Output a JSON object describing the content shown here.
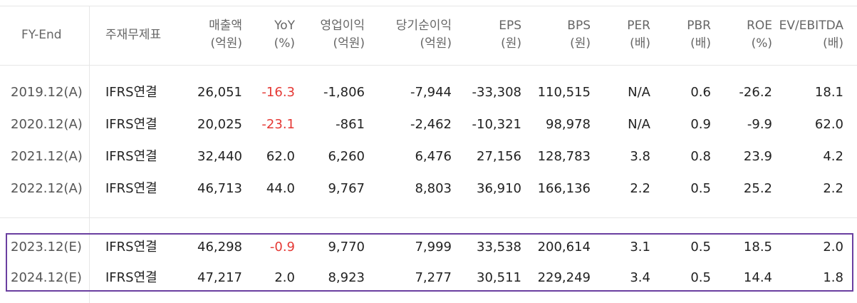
{
  "header": {
    "fy_end": "FY-End",
    "jaemu": "주재무제표",
    "cols": [
      {
        "l1": "매출액",
        "l2": "(억원)"
      },
      {
        "l1": "YoY",
        "l2": "(%)"
      },
      {
        "l1": "영업이익",
        "l2": "(억원)"
      },
      {
        "l1": "당기순이익",
        "l2": "(억원)"
      },
      {
        "l1": "EPS",
        "l2": "(원)"
      },
      {
        "l1": "BPS",
        "l2": "(원)"
      },
      {
        "l1": "PER",
        "l2": "(배)"
      },
      {
        "l1": "PBR",
        "l2": "(배)"
      },
      {
        "l1": "ROE",
        "l2": "(%)"
      },
      {
        "l1": "EV/EBITDA",
        "l2": "(배)"
      }
    ]
  },
  "rows": [
    {
      "fy": "2019.12(A)",
      "std": "IFRS연결",
      "v": [
        "26,051",
        "-16.3",
        "-1,806",
        "-7,944",
        "-33,308",
        "110,515",
        "N/A",
        "0.6",
        "-26.2",
        "18.1"
      ]
    },
    {
      "fy": "2020.12(A)",
      "std": "IFRS연결",
      "v": [
        "20,025",
        "-23.1",
        "-861",
        "-2,462",
        "-10,321",
        "98,978",
        "N/A",
        "0.9",
        "-9.9",
        "62.0"
      ]
    },
    {
      "fy": "2021.12(A)",
      "std": "IFRS연결",
      "v": [
        "32,440",
        "62.0",
        "6,260",
        "6,476",
        "27,156",
        "128,783",
        "3.8",
        "0.8",
        "23.9",
        "4.2"
      ]
    },
    {
      "fy": "2022.12(A)",
      "std": "IFRS연결",
      "v": [
        "46,713",
        "44.0",
        "9,767",
        "8,803",
        "36,910",
        "166,136",
        "2.2",
        "0.5",
        "25.2",
        "2.2"
      ]
    },
    {
      "fy": "2023.12(E)",
      "std": "IFRS연결",
      "v": [
        "46,298",
        "-0.9",
        "9,770",
        "7,999",
        "33,538",
        "200,614",
        "3.1",
        "0.5",
        "18.5",
        "2.0"
      ]
    },
    {
      "fy": "2024.12(E)",
      "std": "IFRS연결",
      "v": [
        "47,217",
        "2.0",
        "8,923",
        "7,277",
        "30,511",
        "229,249",
        "3.4",
        "0.5",
        "14.4",
        "1.8"
      ]
    }
  ],
  "colors": {
    "negative_yoy": "#e53935",
    "highlight_border": "#6a3fa0",
    "grid": "#e6e6e6"
  }
}
